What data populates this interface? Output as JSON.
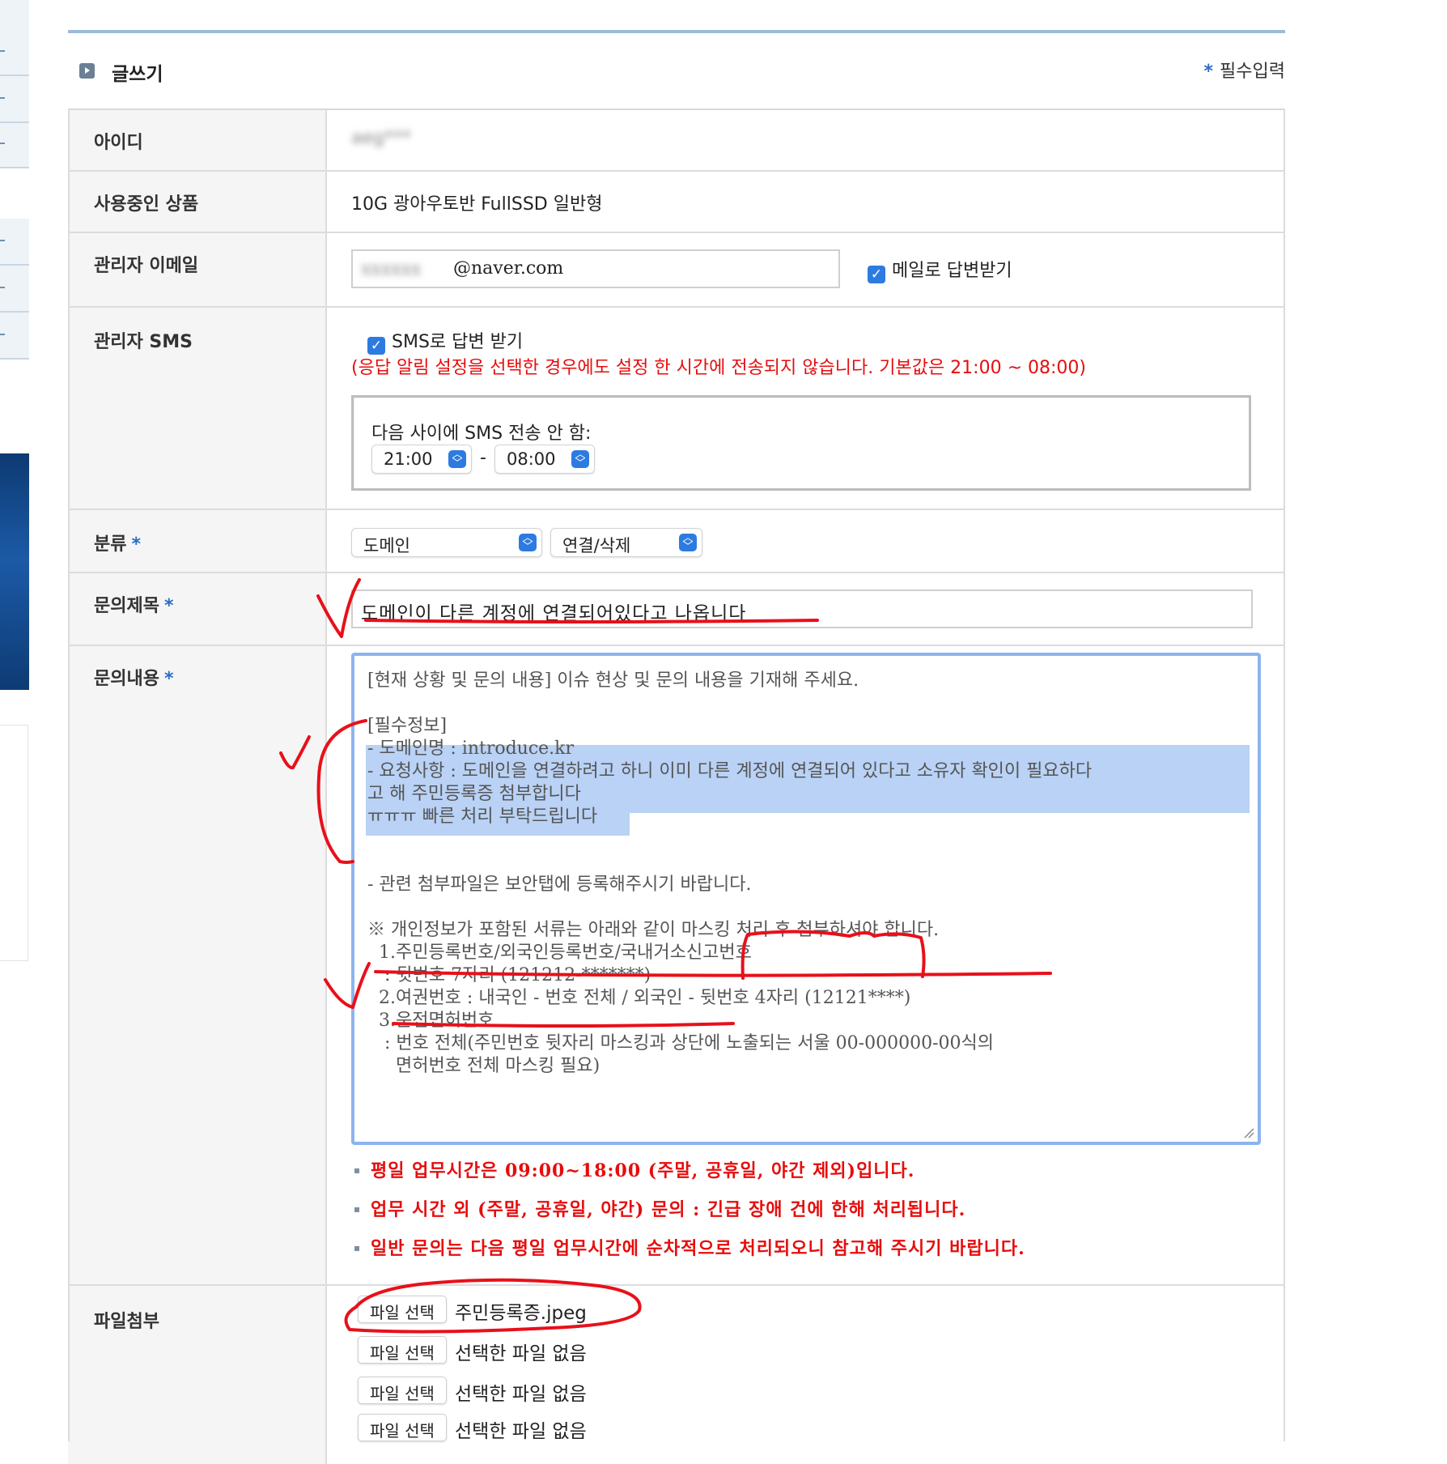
{
  "header": {
    "title": "글쓰기",
    "required_star": "*",
    "required_label": "필수입력"
  },
  "fields": {
    "id": {
      "label": "아이디",
      "value": "aeg***"
    },
    "product": {
      "label": "사용중인 상품",
      "value": "10G 광아우토반 FullSSD 일반형"
    },
    "email": {
      "label": "관리자 이메일",
      "value_hidden": "xxxxxx",
      "value_domain": "@naver.com",
      "checkbox_label": "메일로 답변받기",
      "checked": true
    },
    "sms": {
      "label": "관리자 SMS",
      "checkbox_label": "SMS로 답변 받기",
      "checked": true,
      "warning": "(응답 알림 설정을 선택한 경우에도 설정 한 시간에 전송되지 않습니다. 기본값은 21:00 ~ 08:00)",
      "quiet_label": "다음 사이에 SMS 전송 안 함:",
      "from": "21:00",
      "dash": "-",
      "to": "08:00"
    },
    "category": {
      "label": "분류",
      "star": "*",
      "primary": "도메인",
      "secondary": "연결/삭제"
    },
    "subject": {
      "label": "문의제목",
      "star": "*",
      "value": "도메인이 다른 계정에 연결되어있다고 나옵니다"
    },
    "content": {
      "label": "문의내용",
      "star": "*",
      "lines": [
        "[현재 상황 및 문의 내용] 이슈 현상 및 문의 내용을 기재해 주세요.",
        "[필수정보]",
        "- 도메인명 : introduce.kr",
        "- 요청사항 : 도메인을 연결하려고 하니 이미 다른 계정에 연결되어 있다고 소유자 확인이 필요하다",
        "고 해 주민등록증 첨부합니다",
        "ㅠㅠㅠ 빠른 처리 부탁드립니다",
        "- 관련 첨부파일은 보안탭에 등록해주시기 바랍니다.",
        "※ 개인정보가 포함된 서류는 아래와 같이 마스킹 처리 후 첨부하셔야 합니다.",
        "  1.주민등록번호/외국인등록번호/국내거소신고번호",
        "   : 뒷번호 7자리 (121212-*******)",
        "  2.여권번호 : 내국인 - 번호 전체 / 외국인 - 뒷번호 4자리 (12121****)",
        "  3.운전면허번호",
        "   : 번호 전체(주민번호 뒷자리 마스킹과 상단에 노출되는 서울 00-000000-00식의",
        "     면허번호 전체 마스킹 필요)"
      ],
      "notices": [
        "평일 업무시간은 09:00~18:00 (주말, 공휴일, 야간 제외)입니다.",
        "업무 시간 외 (주말, 공휴일, 야간) 문의 : 긴급 장애 건에 한해 처리됩니다.",
        "일반 문의는 다음 평일 업무시간에 순차적으로 처리되오니 참고해 주시기 바랍니다."
      ]
    },
    "files": {
      "label": "파일첨부",
      "button_label": "파일 선택",
      "items": [
        "주민등록증.jpeg",
        "선택한 파일 없음",
        "선택한 파일 없음",
        "선택한 파일 없음"
      ]
    }
  },
  "colors": {
    "accent_blue": "#2d7be0",
    "warning_red": "#e60d0d",
    "annotation_red": "#e8101a",
    "highlight": "#b9d2f5"
  },
  "icons": [
    "section-bullet-icon",
    "checkbox-checked-icon",
    "select-arrows-icon",
    "resize-grip-icon"
  ]
}
